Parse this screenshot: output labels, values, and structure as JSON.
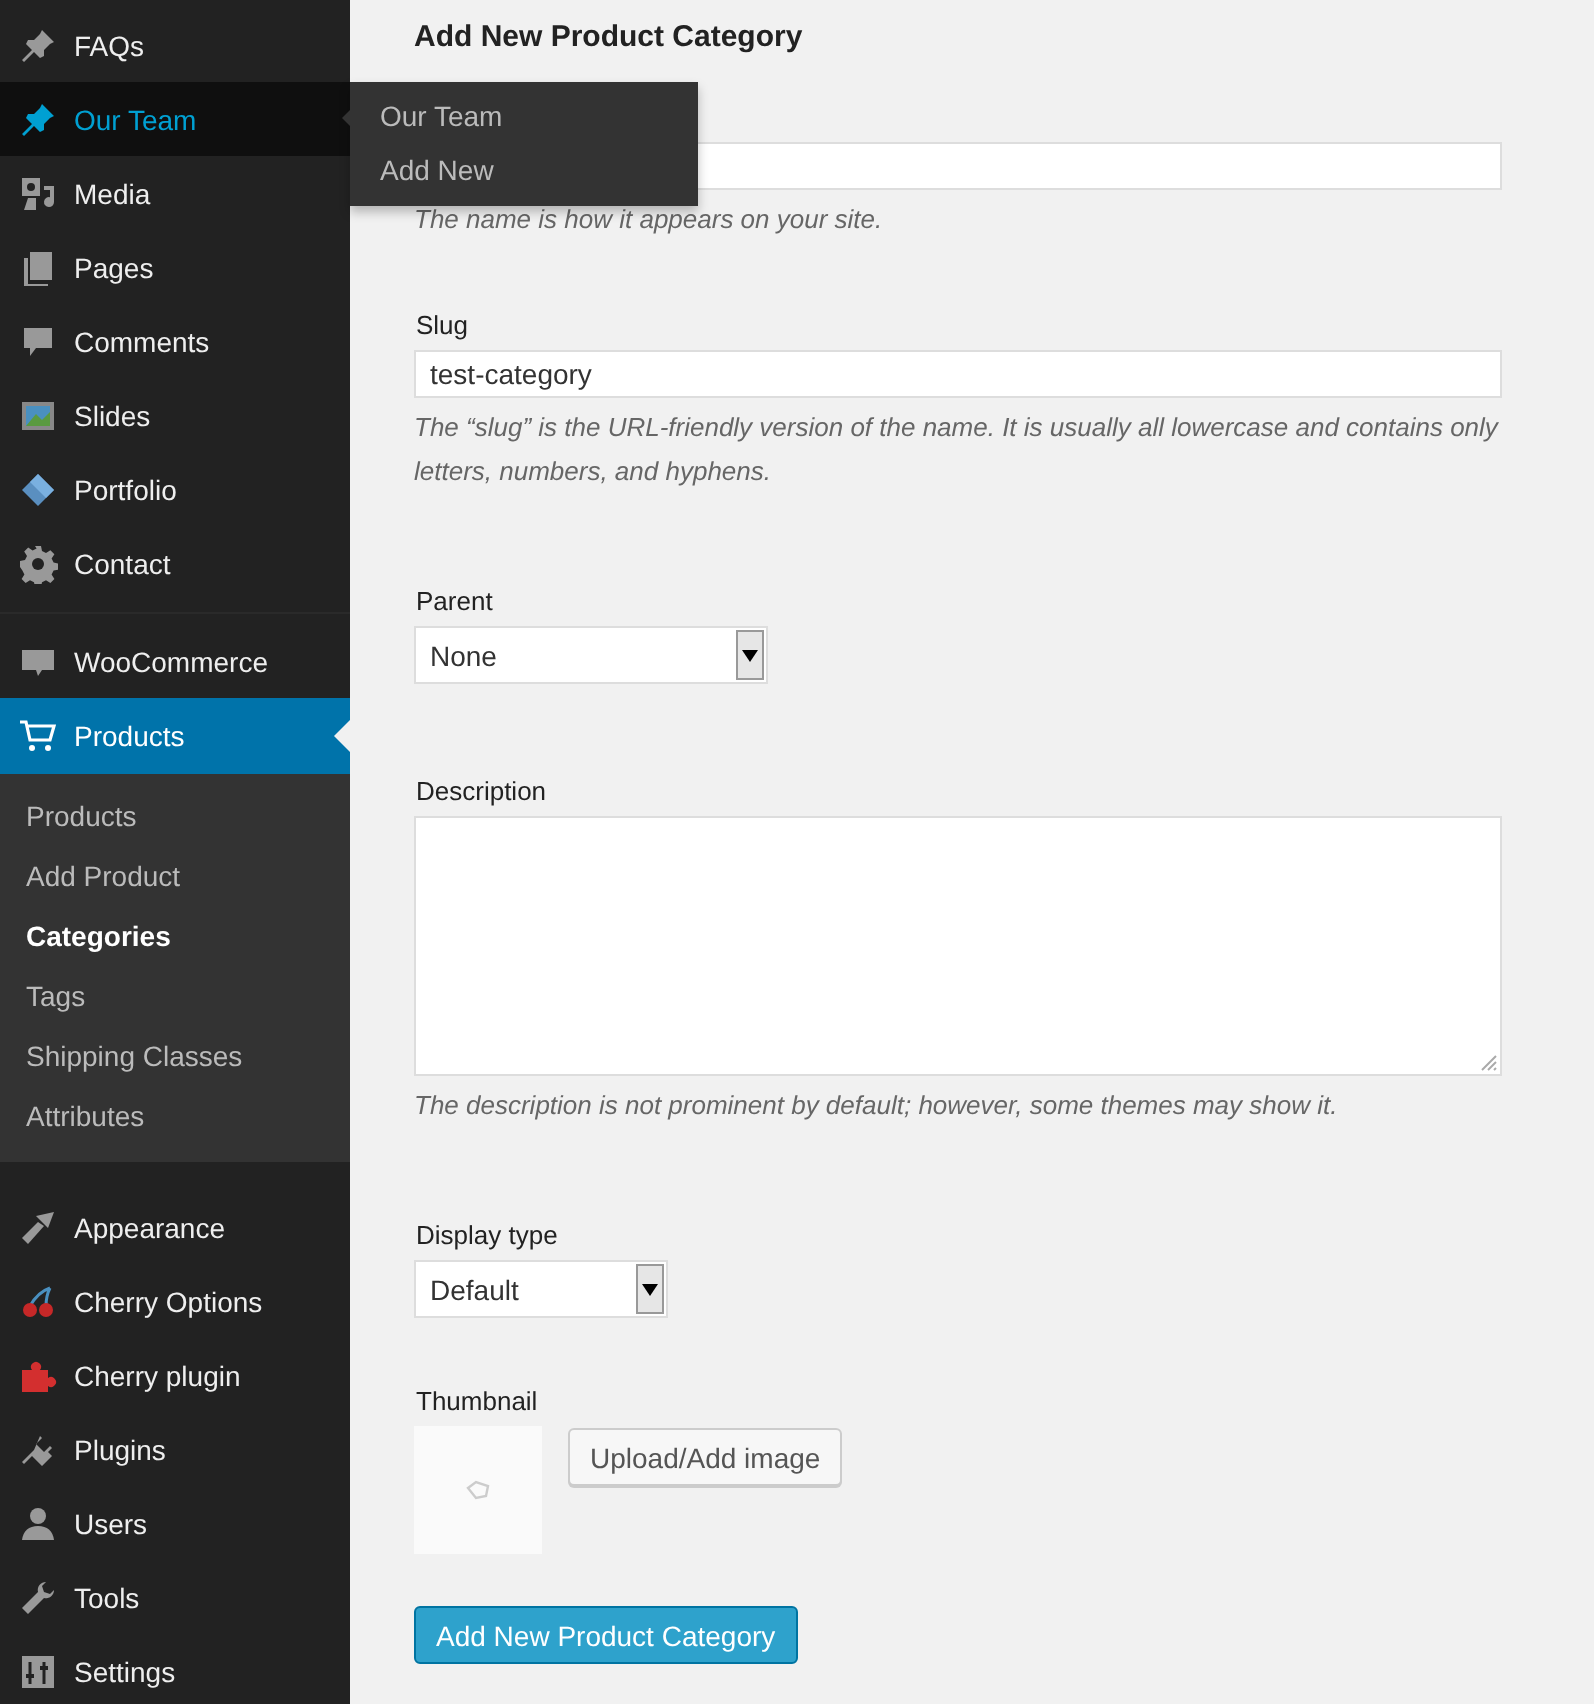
{
  "sidebar": {
    "items": [
      {
        "label": "FAQs",
        "kind": "pin",
        "selected": false,
        "hovered": false
      },
      {
        "label": "Our Team",
        "kind": "pin",
        "selected": false,
        "hovered": true
      },
      {
        "label": "Media",
        "kind": "media",
        "selected": false,
        "hovered": false
      },
      {
        "label": "Pages",
        "kind": "pages",
        "selected": false,
        "hovered": false
      },
      {
        "label": "Comments",
        "kind": "comment",
        "selected": false,
        "hovered": false
      },
      {
        "label": "Slides",
        "kind": "slides",
        "selected": false,
        "hovered": false
      },
      {
        "label": "Portfolio",
        "kind": "diamond",
        "selected": false,
        "hovered": false
      },
      {
        "label": "Contact",
        "kind": "gear",
        "selected": false,
        "hovered": false,
        "separator_after": true
      },
      {
        "label": "WooCommerce",
        "kind": "woo",
        "selected": false,
        "hovered": false
      },
      {
        "label": "Products",
        "kind": "cart",
        "selected": true,
        "hovered": false,
        "submenu": [
          {
            "label": "Products",
            "selected": false
          },
          {
            "label": "Add Product",
            "selected": false
          },
          {
            "label": "Categories",
            "selected": true
          },
          {
            "label": "Tags",
            "selected": false
          },
          {
            "label": "Shipping Classes",
            "selected": false
          },
          {
            "label": "Attributes",
            "selected": false
          }
        ]
      },
      {
        "label": "Appearance",
        "kind": "brush",
        "selected": false,
        "hovered": false
      },
      {
        "label": "Cherry Options",
        "kind": "cherry",
        "selected": false,
        "hovered": false
      },
      {
        "label": "Cherry plugin",
        "kind": "puzzle",
        "selected": false,
        "hovered": false
      },
      {
        "label": "Plugins",
        "kind": "plug",
        "selected": false,
        "hovered": false
      },
      {
        "label": "Users",
        "kind": "user",
        "selected": false,
        "hovered": false
      },
      {
        "label": "Tools",
        "kind": "wrench",
        "selected": false,
        "hovered": false
      },
      {
        "label": "Settings",
        "kind": "sliders",
        "selected": false,
        "hovered": false
      }
    ]
  },
  "flyout": {
    "items": [
      "Our Team",
      "Add New"
    ]
  },
  "form": {
    "title": "Add New Product Category",
    "name_hint": "The name is how it appears on your site.",
    "slug": {
      "label": "Slug",
      "value": "test-category",
      "hint": "The “slug” is the URL-friendly version of the name. It is usually all lowercase and contains only letters, numbers, and hyphens."
    },
    "parent": {
      "label": "Parent",
      "value": "None"
    },
    "description": {
      "label": "Description",
      "hint": "The description is not prominent by default; however, some themes may show it."
    },
    "display_type": {
      "label": "Display type",
      "value": "Default"
    },
    "thumbnail": {
      "label": "Thumbnail",
      "button": "Upload/Add image"
    },
    "submit": "Add New Product Category"
  }
}
